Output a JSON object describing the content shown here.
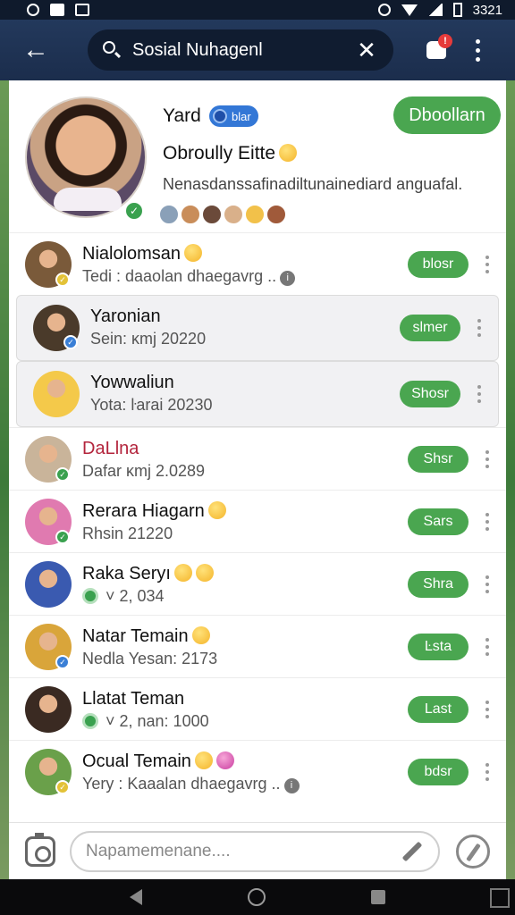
{
  "status_bar": {
    "time": "3321"
  },
  "header": {
    "search_value": "Sosial Nuhagenl",
    "notification_count": "!"
  },
  "profile": {
    "name": "Yard",
    "verified_label": "blar",
    "subtitle": "Obroully Eitte",
    "bio": "Nenasdanssafinadiltunainediard anguafal.",
    "action_label": "Dboollarn",
    "follower_colors": [
      "#8aa0b8",
      "#c98d5a",
      "#6b4a3a",
      "#d9b08a",
      "#f2c14a",
      "#a05a3a"
    ]
  },
  "contacts": [
    {
      "name": "Nialolomsan",
      "sub": "Tedi : daaolan dhaegavrg ..",
      "button": "blosr",
      "emoji": true,
      "info": true,
      "online": false,
      "badge": "yellow",
      "avatar": "#7a5a3a",
      "highlight": false,
      "name_red": false
    },
    {
      "name": "Yaronian",
      "sub": "Sein: κmj 20220",
      "button": "slmer",
      "emoji": false,
      "info": false,
      "online": false,
      "badge": "blue",
      "avatar": "#4a3a2a",
      "highlight": true,
      "name_red": false
    },
    {
      "name": "Yowwaliun",
      "sub": "Yota: ŀarai 20230",
      "button": "Shosr",
      "emoji": false,
      "info": false,
      "online": false,
      "badge": "",
      "avatar": "#f4c94a",
      "highlight": true,
      "name_red": false
    },
    {
      "name": "DaLlna",
      "sub": "Dafar κmj 2.0289",
      "button": "Shsr",
      "emoji": false,
      "info": false,
      "online": false,
      "badge": "green",
      "avatar": "#c9b49a",
      "highlight": false,
      "name_red": true
    },
    {
      "name": "Rerara Hiagarn",
      "sub": "Rhsin 21220",
      "button": "Sars",
      "emoji": true,
      "info": false,
      "online": false,
      "badge": "green",
      "avatar": "#e07ab0",
      "highlight": false,
      "name_red": false
    },
    {
      "name": "Raka Seryı",
      "sub": "˅ 2, 034",
      "button": "Shra",
      "emoji": true,
      "emoji2": true,
      "info": false,
      "online": true,
      "badge": "",
      "avatar": "#3a5ab0",
      "highlight": false,
      "name_red": false
    },
    {
      "name": "Natar Temain",
      "sub": "Nedla Yesan: 2173",
      "button": "Ŀsta",
      "emoji": true,
      "info": false,
      "online": false,
      "badge": "blue",
      "avatar": "#d9a53a",
      "highlight": false,
      "name_red": false
    },
    {
      "name": "Llatat Teman",
      "sub": "˅ 2, nan: 1000",
      "button": "Last",
      "emoji": false,
      "info": false,
      "online": true,
      "badge": "",
      "avatar": "#3a2a22",
      "highlight": false,
      "name_red": false
    },
    {
      "name": "Ocual Temain",
      "sub": "Yery : Kaaalan dhaegavrg ..",
      "button": "bdsr",
      "emoji": true,
      "heart": true,
      "info": true,
      "online": false,
      "badge": "yellow",
      "avatar": "#6aa04a",
      "highlight": false,
      "name_red": false
    }
  ],
  "composer": {
    "placeholder": "Napamemenane...."
  }
}
